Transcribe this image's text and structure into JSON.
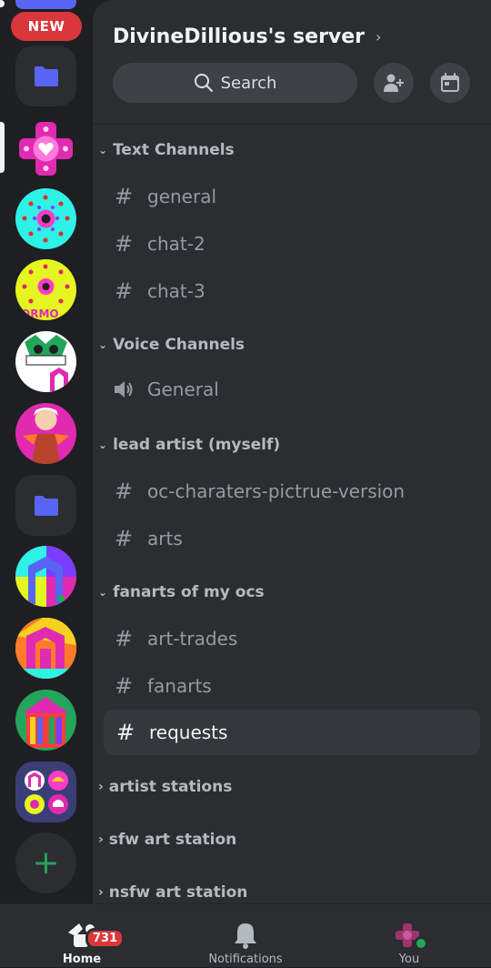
{
  "rail": {
    "new_badge": "NEW",
    "add_label": "+"
  },
  "server": {
    "title": "DivineDillious's server",
    "search_label": "Search"
  },
  "categories": [
    {
      "name": "Text Channels"
    },
    {
      "name": "Voice Channels"
    },
    {
      "name": "lead artist (myself)"
    },
    {
      "name": "fanarts of my ocs"
    },
    {
      "name": "artist stations"
    },
    {
      "name": "sfw art station"
    },
    {
      "name": "nsfw art station"
    }
  ],
  "channels": [
    {
      "name": "general",
      "type": "text"
    },
    {
      "name": "chat-2",
      "type": "text"
    },
    {
      "name": "chat-3",
      "type": "text"
    },
    {
      "name": "General",
      "type": "voice"
    },
    {
      "name": "oc-charaters-pictrue-version",
      "type": "text"
    },
    {
      "name": "arts",
      "type": "text"
    },
    {
      "name": "art-trades",
      "type": "text"
    },
    {
      "name": "fanarts",
      "type": "text"
    },
    {
      "name": "requests",
      "type": "text",
      "active": true
    }
  ],
  "nav": {
    "home_label": "Home",
    "home_badge": "731",
    "notifications_label": "Notifications",
    "you_label": "You"
  },
  "colors": {
    "accent": "#5865f2",
    "danger": "#da373c",
    "online": "#23a55a"
  }
}
